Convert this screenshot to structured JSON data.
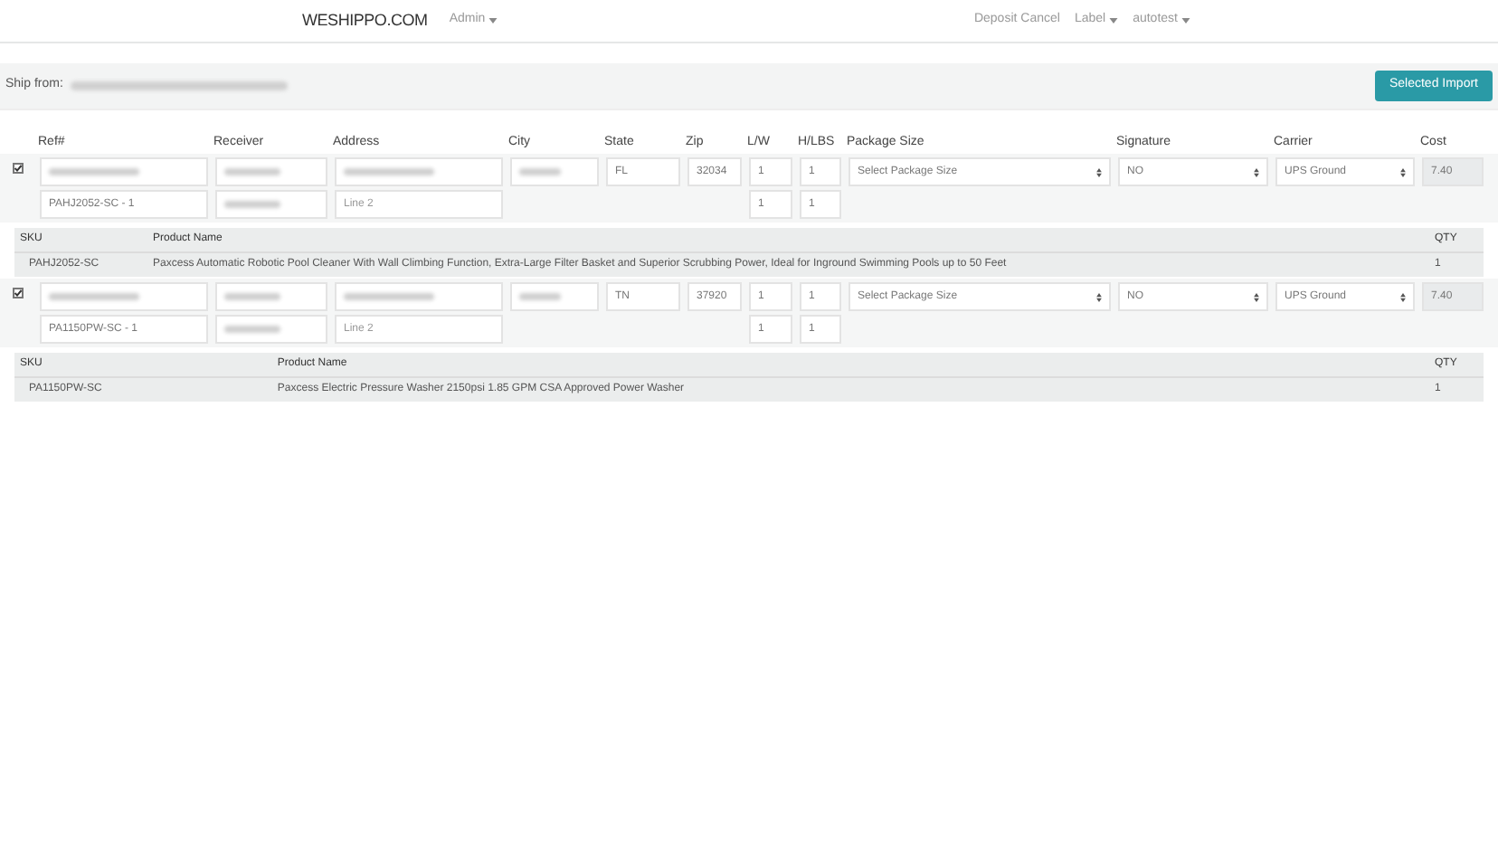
{
  "navbar": {
    "brand": "WESHIPPO.COM",
    "left_menu": [
      {
        "label": "Admin"
      }
    ],
    "right_menu": [
      {
        "label": "Deposit Cancel",
        "dropdown": false
      },
      {
        "label": "Label",
        "dropdown": true
      },
      {
        "label": "autotest",
        "dropdown": true
      }
    ]
  },
  "toolbar": {
    "ship_from_label": "Ship from:",
    "button": "Selected Import"
  },
  "columns": [
    "Ref#",
    "Receiver",
    "Address",
    "City",
    "State",
    "Zip",
    "L/W",
    "H/LBS",
    "Package Size",
    "Signature",
    "Carrier",
    "Cost"
  ],
  "orders": [
    {
      "checked": true,
      "ref_line2": "PAHJ2052-SC - 1",
      "address_line2": {
        "placeholder": "Line 2"
      },
      "state": "FL",
      "zip": "32034",
      "lw": [
        "1",
        "1"
      ],
      "hlbs": [
        "1",
        "1"
      ],
      "package_size": "Select Package Size",
      "signature": "NO",
      "carrier": "UPS Ground",
      "cost": "7.40",
      "products": {
        "columns": [
          "SKU",
          "Product Name",
          "QTY"
        ],
        "rows": [
          [
            "PAHJ2052-SC",
            "Paxcess Automatic Robotic Pool Cleaner With Wall Climbing Function, Extra-Large Filter Basket and Superior Scrubbing Power, Ideal for Inground Swimming Pools up to 50 Feet",
            "1"
          ]
        ]
      }
    },
    {
      "checked": true,
      "ref_line2": "PA1150PW-SC - 1",
      "address_line2": {
        "placeholder": "Line 2"
      },
      "state": "TN",
      "zip": "37920",
      "lw": [
        "1",
        "1"
      ],
      "hlbs": [
        "1",
        "1"
      ],
      "package_size": "Select Package Size",
      "signature": "NO",
      "carrier": "UPS Ground",
      "cost": "7.40",
      "products": {
        "columns": [
          "SKU",
          "Product Name",
          "QTY"
        ],
        "rows": [
          [
            "PA1150PW-SC",
            "Paxcess Electric Pressure Washer 2150psi 1.85 GPM CSA Approved Power Washer",
            "1"
          ]
        ]
      }
    }
  ]
}
